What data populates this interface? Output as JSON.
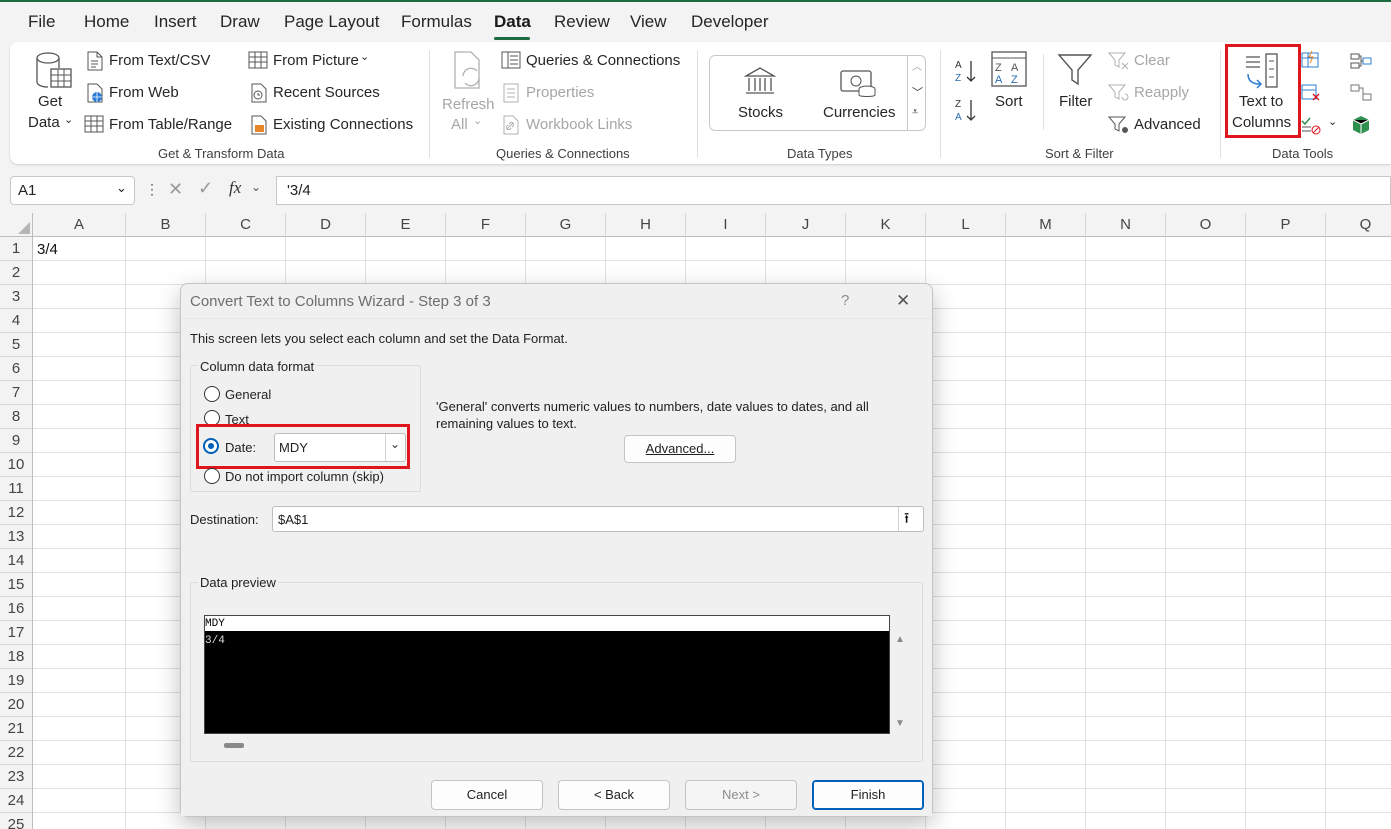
{
  "menu": {
    "items": [
      "File",
      "Home",
      "Insert",
      "Draw",
      "Page Layout",
      "Formulas",
      "Data",
      "Review",
      "View",
      "Developer"
    ],
    "active": "Data"
  },
  "ribbon": {
    "get_transform": {
      "get_data_1": "Get",
      "get_data_2": "Data",
      "from_text_csv": "From Text/CSV",
      "from_web": "From Web",
      "from_table_range": "From Table/Range",
      "from_picture": "From Picture",
      "recent_sources": "Recent Sources",
      "existing_connections": "Existing Connections",
      "group_label": "Get & Transform Data"
    },
    "queries": {
      "refresh_1": "Refresh",
      "refresh_2": "All",
      "queries_connections": "Queries & Connections",
      "properties": "Properties",
      "workbook_links": "Workbook Links",
      "group_label": "Queries & Connections"
    },
    "data_types": {
      "stocks": "Stocks",
      "currencies": "Currencies",
      "group_label": "Data Types"
    },
    "sort_filter": {
      "sort": "Sort",
      "filter": "Filter",
      "clear": "Clear",
      "reapply": "Reapply",
      "advanced": "Advanced",
      "group_label": "Sort & Filter"
    },
    "data_tools": {
      "text_to_1": "Text to",
      "text_to_2": "Columns",
      "group_label": "Data Tools"
    }
  },
  "formula_bar": {
    "name_box": "A1",
    "fx": "fx",
    "content": "'3/4"
  },
  "sheet": {
    "columns": [
      "A",
      "B",
      "C",
      "D",
      "E",
      "F",
      "G",
      "H",
      "I",
      "J",
      "K",
      "L",
      "M",
      "N",
      "O",
      "P",
      "Q"
    ],
    "rows": [
      "1",
      "2",
      "3",
      "4",
      "5",
      "6",
      "7",
      "8",
      "9",
      "10",
      "11",
      "12",
      "13",
      "14",
      "15",
      "16",
      "17",
      "18",
      "19",
      "20",
      "21",
      "22",
      "23",
      "24",
      "25"
    ],
    "a1": "3/4"
  },
  "dialog": {
    "title": "Convert Text to Columns Wizard - Step 3 of 3",
    "help": "?",
    "close": "✕",
    "intro": "This screen lets you select each column and set the Data Format.",
    "format_legend": "Column data format",
    "opt_general": "General",
    "opt_text": "Text",
    "opt_date": "Date:",
    "opt_skip": "Do not import column (skip)",
    "date_format": "MDY",
    "explain_1": "'General' converts numeric values to numbers, date values to dates, and all",
    "explain_2": "remaining values to text.",
    "advanced_btn": "Advanced...",
    "destination_label": "Destination:",
    "destination_value": "$A$1",
    "preview_legend": "Data preview",
    "preview_header": "MDY",
    "preview_row": "3/4",
    "cancel": "Cancel",
    "back": "< Back",
    "next": "Next >",
    "finish": "Finish"
  }
}
